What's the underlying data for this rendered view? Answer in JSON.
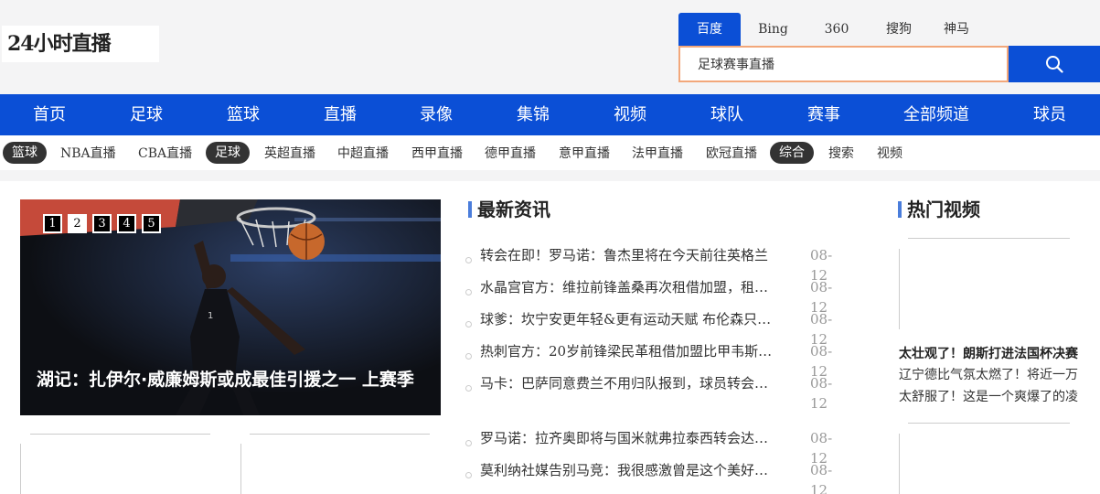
{
  "header": {
    "logo": "24小时直播",
    "engines": [
      "百度",
      "Bing",
      "360",
      "搜狗",
      "神马"
    ],
    "active_engine": "百度",
    "search_value": "足球赛事直播"
  },
  "nav": [
    "首页",
    "足球",
    "篮球",
    "直播",
    "录像",
    "集锦",
    "视频",
    "球队",
    "赛事",
    "全部频道",
    "球员"
  ],
  "subnav": {
    "basketball_tag": "篮球",
    "basketball": [
      "NBA直播",
      "CBA直播"
    ],
    "football_tag": "足球",
    "football": [
      "英超直播",
      "中超直播",
      "西甲直播",
      "德甲直播",
      "意甲直播",
      "法甲直播",
      "欧冠直播"
    ],
    "general_tag": "综合",
    "general": [
      "搜索",
      "视频"
    ]
  },
  "slider": {
    "caption": "湖记：扎伊尔·威廉姆斯或成最佳引援之一 上赛季",
    "pages": [
      "1",
      "2",
      "3",
      "4",
      "5"
    ],
    "active_page": "2"
  },
  "latest_news": {
    "title": "最新资讯",
    "items": [
      {
        "title": "转会在即！罗马诺：鲁杰里将在今天前往英格兰",
        "date": "08-12"
      },
      {
        "title": "水晶宫官方：维拉前锋盖桑再次租借加盟，租借至",
        "date": "08-12"
      },
      {
        "title": "球爹：坎宁安更年轻&更有运动天赋 布伦森只是更",
        "date": "08-12"
      },
      {
        "title": "热刺官方：20岁前锋梁民革租借加盟比甲韦斯特洛",
        "date": "08-12"
      },
      {
        "title": "马卡：巴萨同意费兰不用归队报到，球员转会瓦伦",
        "date": "08-12"
      },
      {
        "title": "罗马诺：拉齐奥即将与国米就弗拉泰西转会达成协议",
        "date": "08-12"
      },
      {
        "title": "莫利纳社媒告别马竞：我很感激曾是这个美好家庭",
        "date": "08-12"
      }
    ]
  },
  "hot_videos": {
    "title": "热门视频",
    "items": [
      {
        "title": "太壮观了！朗斯打进法国杯决赛",
        "desc": "辽宁德比气氛太燃了！将近一万太舒服了！这是一个爽爆了的凌晨"
      }
    ]
  }
}
